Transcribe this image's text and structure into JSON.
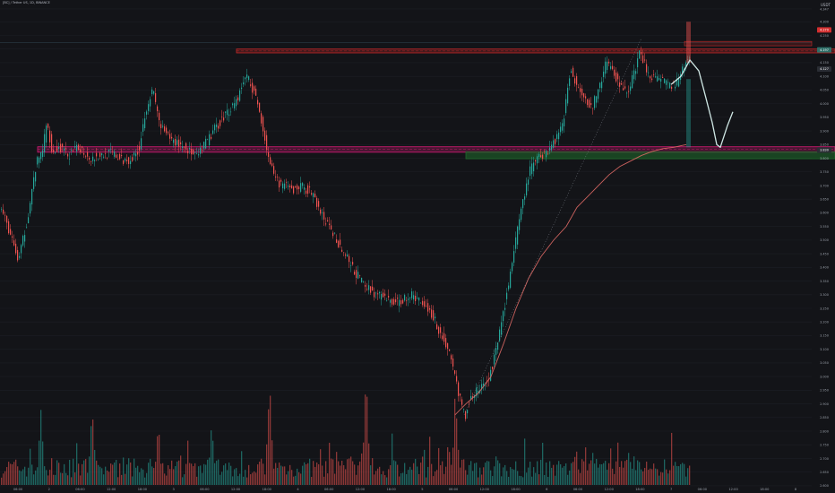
{
  "header": {
    "symbol": "[BC] / Tether US, 1D, BINANCE",
    "currency": "USDT"
  },
  "colors": {
    "background": "#131418",
    "up": "#26a69a",
    "down": "#ef5350",
    "resistance_zone": "#c62828",
    "support_zone": "#d81b78",
    "demand_zone": "#1f6b2b",
    "projection_line": "#cfe7e4",
    "moving_average": "#e06a66",
    "price_label": "#d32f2f",
    "current_label": "#2e6f68"
  },
  "chart_data": {
    "type": "candlestick",
    "title": "",
    "price_axis": {
      "ylim": [
        2.58,
        4.36
      ],
      "ticks": [
        "4.347",
        "4.300",
        "4.250",
        "4.200",
        "4.150",
        "4.100",
        "4.050",
        "4.000",
        "3.950",
        "3.900",
        "3.850",
        "3.800",
        "3.750",
        "3.700",
        "3.650",
        "3.600",
        "3.550",
        "3.500",
        "3.450",
        "3.400",
        "3.350",
        "3.300",
        "3.250",
        "3.200",
        "3.150",
        "3.100",
        "3.050",
        "3.000",
        "2.950",
        "2.900",
        "2.850",
        "2.800",
        "2.750",
        "2.700",
        "2.650",
        "2.600"
      ],
      "highlight_labels": [
        {
          "text": "4.270",
          "price": 4.27,
          "kind": "resistance"
        },
        {
          "text": "4.197",
          "price": 4.197,
          "kind": "current"
        },
        {
          "text": "4.127",
          "price": 4.127,
          "kind": "level"
        },
        {
          "text": "3.830",
          "price": 3.83,
          "kind": "level"
        }
      ]
    },
    "time_axis": {
      "ticks": [
        "06:00",
        "2",
        "06:00",
        "12:00",
        "18:00",
        "3",
        "06:00",
        "12:00",
        "18:00",
        "4",
        "06:00",
        "12:00",
        "18:00",
        "5",
        "06:00",
        "12:00",
        "18:00",
        "6",
        "06:00",
        "12:00",
        "18:00",
        "7",
        "06:00",
        "12:00",
        "18:00",
        "8"
      ]
    },
    "price_path": [
      [
        0,
        3.62
      ],
      [
        8,
        3.55
      ],
      [
        20,
        3.42
      ],
      [
        30,
        3.58
      ],
      [
        40,
        3.78
      ],
      [
        46,
        3.82
      ],
      [
        52,
        3.93
      ],
      [
        58,
        3.82
      ],
      [
        66,
        3.84
      ],
      [
        76,
        3.81
      ],
      [
        88,
        3.84
      ],
      [
        100,
        3.8
      ],
      [
        112,
        3.81
      ],
      [
        124,
        3.82
      ],
      [
        136,
        3.79
      ],
      [
        148,
        3.8
      ],
      [
        155,
        3.84
      ],
      [
        162,
        3.98
      ],
      [
        170,
        4.05
      ],
      [
        178,
        3.92
      ],
      [
        186,
        3.88
      ],
      [
        194,
        3.86
      ],
      [
        202,
        3.85
      ],
      [
        210,
        3.83
      ],
      [
        218,
        3.8
      ],
      [
        228,
        3.85
      ],
      [
        238,
        3.9
      ],
      [
        246,
        3.94
      ],
      [
        256,
        3.98
      ],
      [
        266,
        4.03
      ],
      [
        274,
        4.11
      ],
      [
        282,
        4.05
      ],
      [
        290,
        3.96
      ],
      [
        298,
        3.82
      ],
      [
        306,
        3.72
      ],
      [
        316,
        3.7
      ],
      [
        326,
        3.68
      ],
      [
        336,
        3.7
      ],
      [
        348,
        3.67
      ],
      [
        360,
        3.58
      ],
      [
        372,
        3.52
      ],
      [
        384,
        3.45
      ],
      [
        396,
        3.38
      ],
      [
        408,
        3.33
      ],
      [
        420,
        3.3
      ],
      [
        432,
        3.28
      ],
      [
        444,
        3.27
      ],
      [
        456,
        3.3
      ],
      [
        468,
        3.28
      ],
      [
        480,
        3.24
      ],
      [
        492,
        3.15
      ],
      [
        502,
        3.08
      ],
      [
        512,
        2.93
      ],
      [
        518,
        2.85
      ],
      [
        524,
        2.92
      ],
      [
        532,
        2.95
      ],
      [
        542,
        2.97
      ],
      [
        550,
        3.05
      ],
      [
        558,
        3.18
      ],
      [
        566,
        3.32
      ],
      [
        574,
        3.48
      ],
      [
        582,
        3.62
      ],
      [
        590,
        3.75
      ],
      [
        598,
        3.8
      ],
      [
        608,
        3.82
      ],
      [
        618,
        3.86
      ],
      [
        628,
        3.94
      ],
      [
        636,
        4.12
      ],
      [
        644,
        4.07
      ],
      [
        652,
        4.03
      ],
      [
        660,
        3.98
      ],
      [
        668,
        4.06
      ],
      [
        676,
        4.15
      ],
      [
        684,
        4.12
      ],
      [
        692,
        4.06
      ],
      [
        700,
        4.04
      ],
      [
        708,
        4.12
      ],
      [
        714,
        4.19
      ],
      [
        722,
        4.12
      ],
      [
        730,
        4.09
      ],
      [
        738,
        4.08
      ],
      [
        746,
        4.07
      ],
      [
        752,
        4.06
      ],
      [
        758,
        4.1
      ],
      [
        764,
        4.14
      ],
      [
        768,
        4.17
      ]
    ],
    "moving_average_path": [
      [
        508,
        2.86
      ],
      [
        520,
        2.9
      ],
      [
        534,
        2.94
      ],
      [
        548,
        3.0
      ],
      [
        562,
        3.12
      ],
      [
        576,
        3.25
      ],
      [
        590,
        3.36
      ],
      [
        604,
        3.44
      ],
      [
        618,
        3.5
      ],
      [
        632,
        3.55
      ],
      [
        644,
        3.62
      ],
      [
        656,
        3.66
      ],
      [
        668,
        3.7
      ],
      [
        680,
        3.74
      ],
      [
        692,
        3.77
      ],
      [
        704,
        3.79
      ],
      [
        716,
        3.81
      ],
      [
        728,
        3.825
      ],
      [
        740,
        3.835
      ],
      [
        752,
        3.84
      ],
      [
        766,
        3.85
      ]
    ],
    "projection_path": [
      [
        749,
        4.07
      ],
      [
        760,
        4.1
      ],
      [
        770,
        4.16
      ],
      [
        780,
        4.12
      ],
      [
        788,
        4.02
      ],
      [
        795,
        3.93
      ],
      [
        800,
        3.85
      ],
      [
        804,
        3.84
      ],
      [
        808,
        3.88
      ],
      [
        812,
        3.92
      ],
      [
        818,
        3.97
      ]
    ],
    "zones": [
      {
        "name": "resistance",
        "price_top": 4.2,
        "price_bottom": 4.186,
        "x_start": 264,
        "x_end": 932
      },
      {
        "name": "support",
        "price_top": 3.842,
        "price_bottom": 3.822,
        "x_start": 42,
        "x_end": 932
      },
      {
        "name": "demand",
        "price_top": 3.823,
        "price_bottom": 3.798,
        "x_start": 520,
        "x_end": 932
      }
    ],
    "volume_axis": {
      "max": 1.0
    },
    "volume_peaks": [
      [
        45,
        0.7
      ],
      [
        102,
        0.72
      ],
      [
        176,
        0.52
      ],
      [
        236,
        0.58
      ],
      [
        300,
        0.96
      ],
      [
        408,
        1.0
      ],
      [
        500,
        0.45
      ],
      [
        508,
        0.82
      ],
      [
        642,
        0.38
      ],
      [
        700,
        0.34
      ],
      [
        768,
        0.22
      ]
    ]
  }
}
